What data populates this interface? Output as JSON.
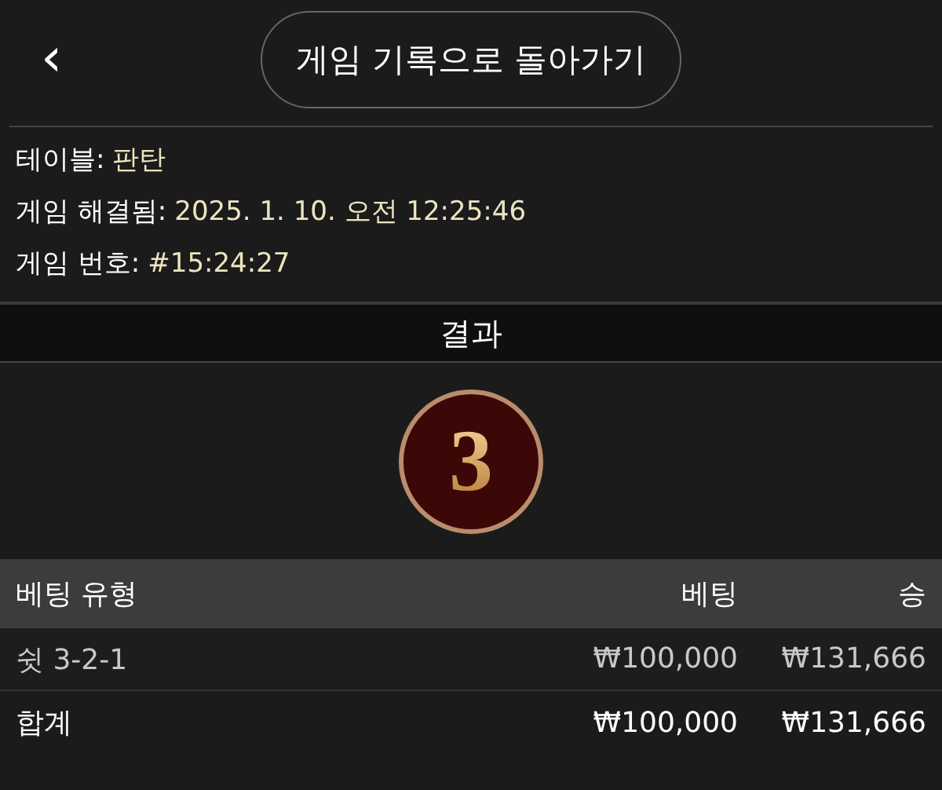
{
  "back_button": {
    "label": "‹"
  },
  "title_button": {
    "label": "게임 기록으로 돌아가기"
  },
  "info": [
    {
      "label": "테이블:",
      "value": "판탄"
    },
    {
      "label": "게임 해결됨:",
      "value": "2025. 1. 10. 오전 12:25:46"
    },
    {
      "label": "게임 번호:",
      "value": "#15:24:27"
    }
  ],
  "result": {
    "heading": "결과",
    "number": "3"
  },
  "table": {
    "columns": [
      "베팅 유형",
      "베팅",
      "승"
    ],
    "rows": [
      {
        "kind": "bet",
        "cells": [
          "쉿 3-2-1",
          "₩100,000",
          "₩131,666"
        ]
      },
      {
        "kind": "total",
        "cells": [
          "합계",
          "₩100,000",
          "₩131,666"
        ]
      }
    ]
  }
}
